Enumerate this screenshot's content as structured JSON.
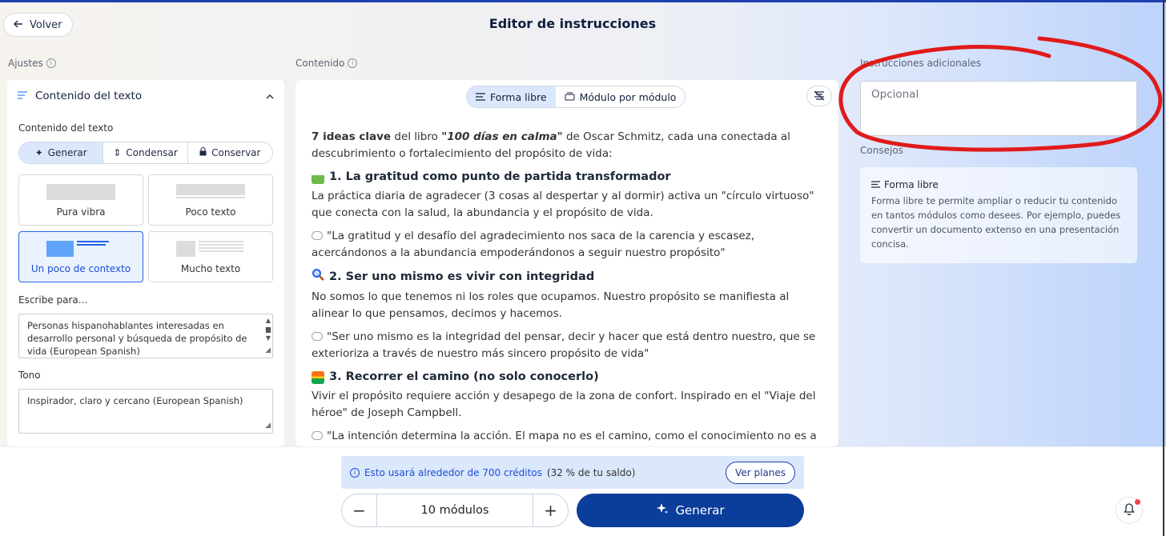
{
  "header": {
    "back_label": "Volver",
    "title": "Editor de instrucciones"
  },
  "left": {
    "section_label": "Ajustes",
    "panel_title": "Contenido del texto",
    "content_label": "Contenido del texto",
    "modes": [
      "Generar",
      "Condensar",
      "Conservar"
    ],
    "selected_mode": "Generar",
    "text_amounts": [
      "Pura vibra",
      "Poco texto",
      "Un poco de contexto",
      "Mucho texto"
    ],
    "selected_amount": "Un poco de contexto",
    "audience_label": "Escribe para...",
    "audience_value": "Personas hispanohablantes interesadas en desarrollo personal y búsqueda de propósito de vida (European Spanish)",
    "tone_label": "Tono",
    "tone_value": "Inspirador, claro y cercano (European Spanish)"
  },
  "center": {
    "section_label": "Contenido",
    "modes": [
      "Forma libre",
      "Módulo por módulo"
    ],
    "selected_mode": "Forma libre",
    "intro_bold": "7 ideas clave",
    "intro_text1": " del libro ",
    "intro_book": "\"100 días en calma\"",
    "intro_text2": " de Oscar Schmitz, cada una conectada al descubrimiento o fortalecimiento del propósito de vida:",
    "ideas": [
      {
        "heading": "1. La gratitud como punto de partida transformador",
        "body": "La práctica diaria de agradecer (3 cosas al despertar y al dormir) activa un \"círculo virtuoso\" que conecta con la salud, la abundancia y el propósito de vida.",
        "quote": "\"La gratitud y el desafío del agradecimiento nos saca de la carencia y escasez, acercándonos a la abundancia empoderándonos a seguir nuestro propósito\""
      },
      {
        "heading": "2. Ser uno mismo es vivir con integridad",
        "body": "No somos lo que tenemos ni los roles que ocupamos. Nuestro propósito se manifiesta al alinear lo que pensamos, decimos y hacemos.",
        "quote": "\"Ser uno mismo es la integridad del pensar, decir y hacer que está dentro nuestro, que se exterioriza a través de nuestro más sincero propósito de vida\""
      },
      {
        "heading": "3. Recorrer el camino (no solo conocerlo)",
        "body": "Vivir el propósito requiere acción y desapego de la zona de confort. Inspirado en el \"Viaje del héroe\" de Joseph Campbell.",
        "quote": "\"La intención determina la acción. El mapa no es el camino, como el conocimiento no es a la"
      }
    ]
  },
  "right": {
    "section_label": "Instrucciones adicionales",
    "instructions_placeholder": "Opcional",
    "tips_label": "Consejos",
    "tip_title": "Forma libre",
    "tip_text": "Forma libre te permite ampliar o reducir tu contenido en tantos módulos como desees. Por ejemplo, puedes convertir un documento extenso en una presentación concisa."
  },
  "bottom": {
    "credits_strong": "Esto usará alrededor de 700 créditos",
    "credits_rest": "(32 % de tu saldo)",
    "plans_label": "Ver planes",
    "modules_value": "10 módulos",
    "generate_label": "Generar"
  },
  "colors": {
    "primary": "#0b3d9a",
    "accent_light": "#dbe8fb",
    "annotation_red": "#e01b1b",
    "notification_dot": "#ef4444"
  }
}
